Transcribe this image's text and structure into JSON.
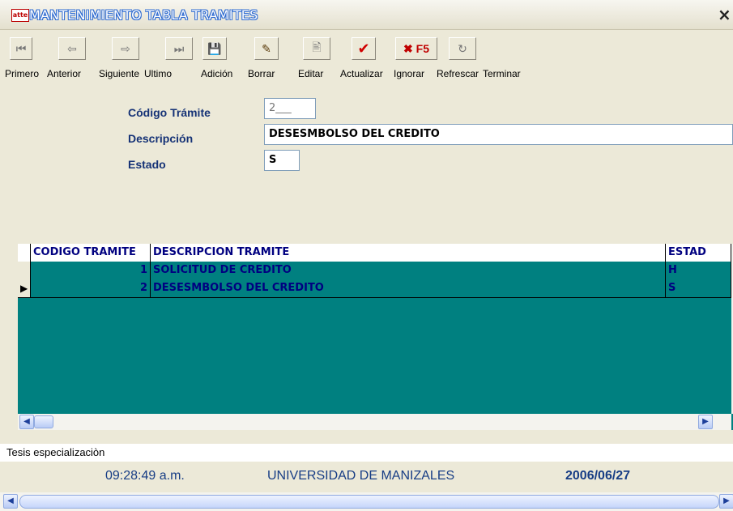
{
  "window": {
    "title": "MANTENIMIENTO TABLA TRAMITES",
    "close": "×",
    "app_icon": "atte"
  },
  "toolbar": {
    "buttons": [
      {
        "name": "first-record-icon",
        "glyph": "⏮"
      },
      {
        "name": "prev-record-icon",
        "glyph": "⇦"
      },
      {
        "name": "next-record-icon",
        "glyph": "⇨"
      },
      {
        "name": "last-record-icon",
        "glyph": "⏭"
      },
      {
        "name": "save-icon",
        "glyph": "💾"
      },
      {
        "name": "eraser-icon",
        "glyph": "✎"
      },
      {
        "name": "edit-icon",
        "glyph": "🖹"
      },
      {
        "name": "checkmark-icon",
        "glyph": "✔"
      },
      {
        "name": "cancel-f5-icon",
        "glyph": "✖ F5"
      },
      {
        "name": "refresh-icon",
        "glyph": "↻"
      }
    ],
    "labels": [
      "Primero",
      "Anterior",
      "Siguiente",
      "Ultimo",
      "Adición",
      "Borrar",
      "Editar",
      "Actualizar",
      "Ignorar",
      "Refrescar",
      "Terminar"
    ]
  },
  "form": {
    "codigo_label": "Código Trámite",
    "codigo_value": "2___",
    "descripcion_label": "Descripción",
    "descripcion_value": "DESESMBOLSO DEL CREDITO",
    "estado_label": "Estado",
    "estado_value": "S"
  },
  "grid": {
    "columns": [
      "CODIGO TRAMITE",
      "DESCRIPCION TRAMITE",
      "ESTAD"
    ],
    "rows": [
      {
        "codigo": "1",
        "descripcion": "SOLICITUD DE CREDITO",
        "estado": "H"
      },
      {
        "codigo": "2",
        "descripcion": "DESESMBOLSO DEL CREDITO",
        "estado": "S"
      }
    ],
    "current_row_marker": "▶",
    "current_row": 2,
    "colors": {
      "background": "#008080",
      "text": "#000080"
    }
  },
  "status": {
    "tesis": "Tesis especializaciòn",
    "time": "09:28:49 a.m.",
    "university": "UNIVERSIDAD DE MANIZALES",
    "date": "2006/06/27"
  }
}
